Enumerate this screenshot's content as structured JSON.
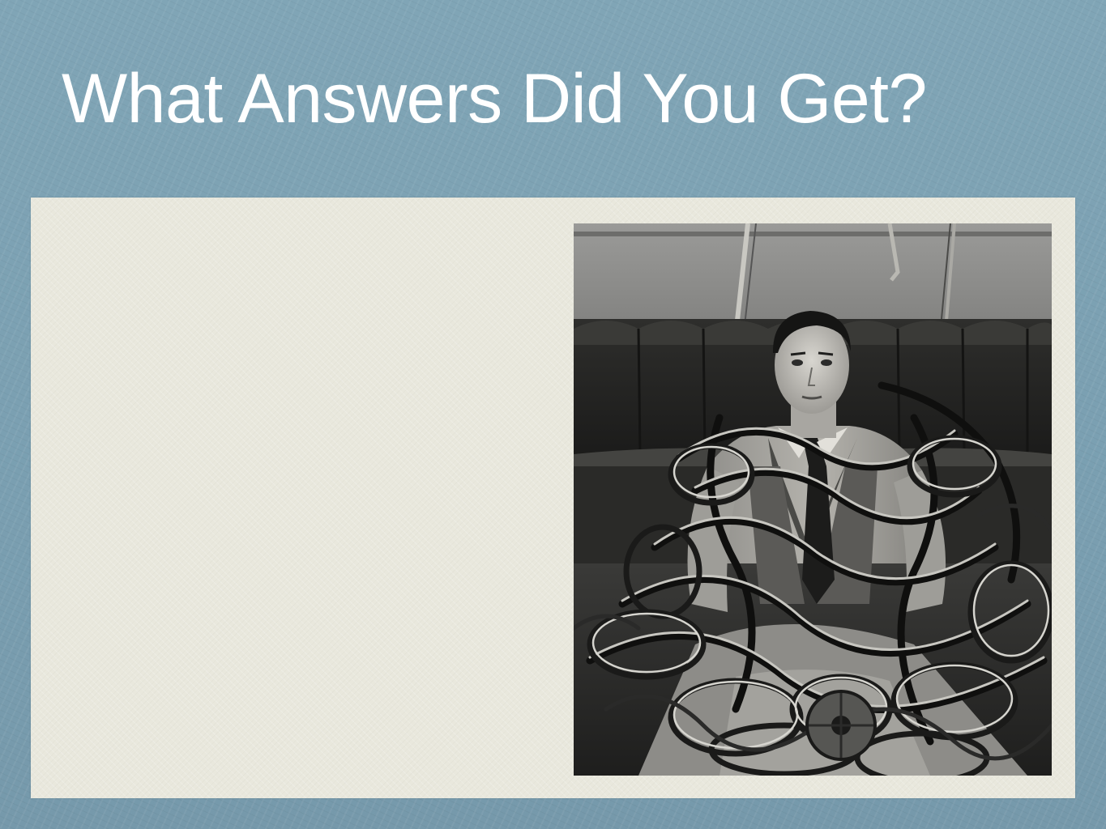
{
  "slide": {
    "title": "What Answers Did You Get?"
  },
  "photo": {
    "icon": "vintage-photo-person-tangled-in-film-reels"
  },
  "colors": {
    "background": "#7da2b3",
    "panel": "#e9e8dd",
    "title_text": "#ffffff"
  }
}
